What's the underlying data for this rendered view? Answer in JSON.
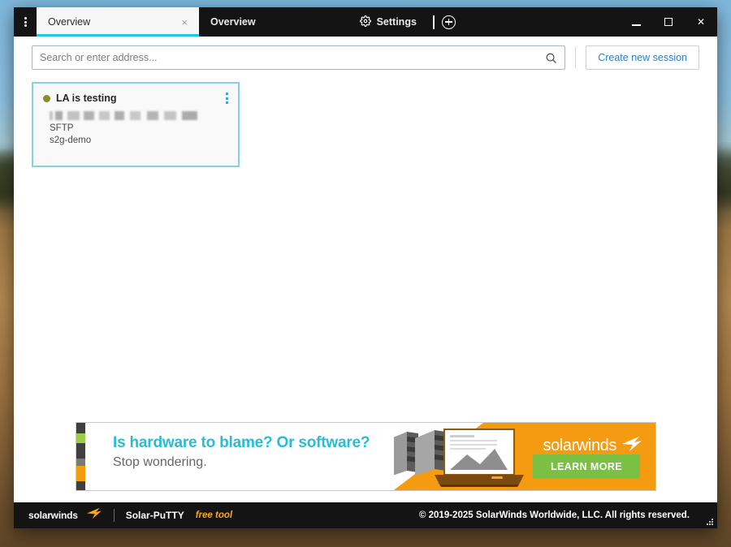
{
  "window": {
    "app_menu_icon": "kebab-menu-icon",
    "minimize_label": "Minimize",
    "maximize_label": "Maximize",
    "close_label": "✕"
  },
  "tabs": [
    {
      "label": "Overview",
      "close": "×",
      "active": true
    },
    {
      "label": "Overview",
      "active": false
    }
  ],
  "settings_tab": {
    "label": "Settings",
    "icon": "gear-icon"
  },
  "new_tab": {
    "icon": "plus-circle-icon",
    "label": "New session tab"
  },
  "toolbar": {
    "search_placeholder": "Search or enter address...",
    "search_value": "",
    "search_icon": "search-icon",
    "create_session_label": "Create new session"
  },
  "session_card": {
    "title": "LA is testing",
    "status_color": "#8b8b28",
    "menu_icon": "kebab-menu-icon",
    "address_redacted": true,
    "protocol": "SFTP",
    "credential": "s2g-demo"
  },
  "ad": {
    "headline": "Is hardware to blame? Or software?",
    "subhead": "Stop wondering.",
    "brand": "solarwinds",
    "cta": "LEARN MORE",
    "accent_orange": "#f59b12",
    "accent_green": "#7bc043",
    "accent_cyan": "#26bdd6",
    "stripe_colors": [
      "#3f3f3f",
      "#9acd48",
      "#3f3f3f",
      "#7a7a7a",
      "#f59b12",
      "#3f3f3f"
    ]
  },
  "footer": {
    "brand": "solarwinds",
    "product": "Solar-PuTTY",
    "tag": "free tool",
    "copyright": "© 2019-2025 SolarWinds Worldwide, LLC. All rights reserved."
  }
}
